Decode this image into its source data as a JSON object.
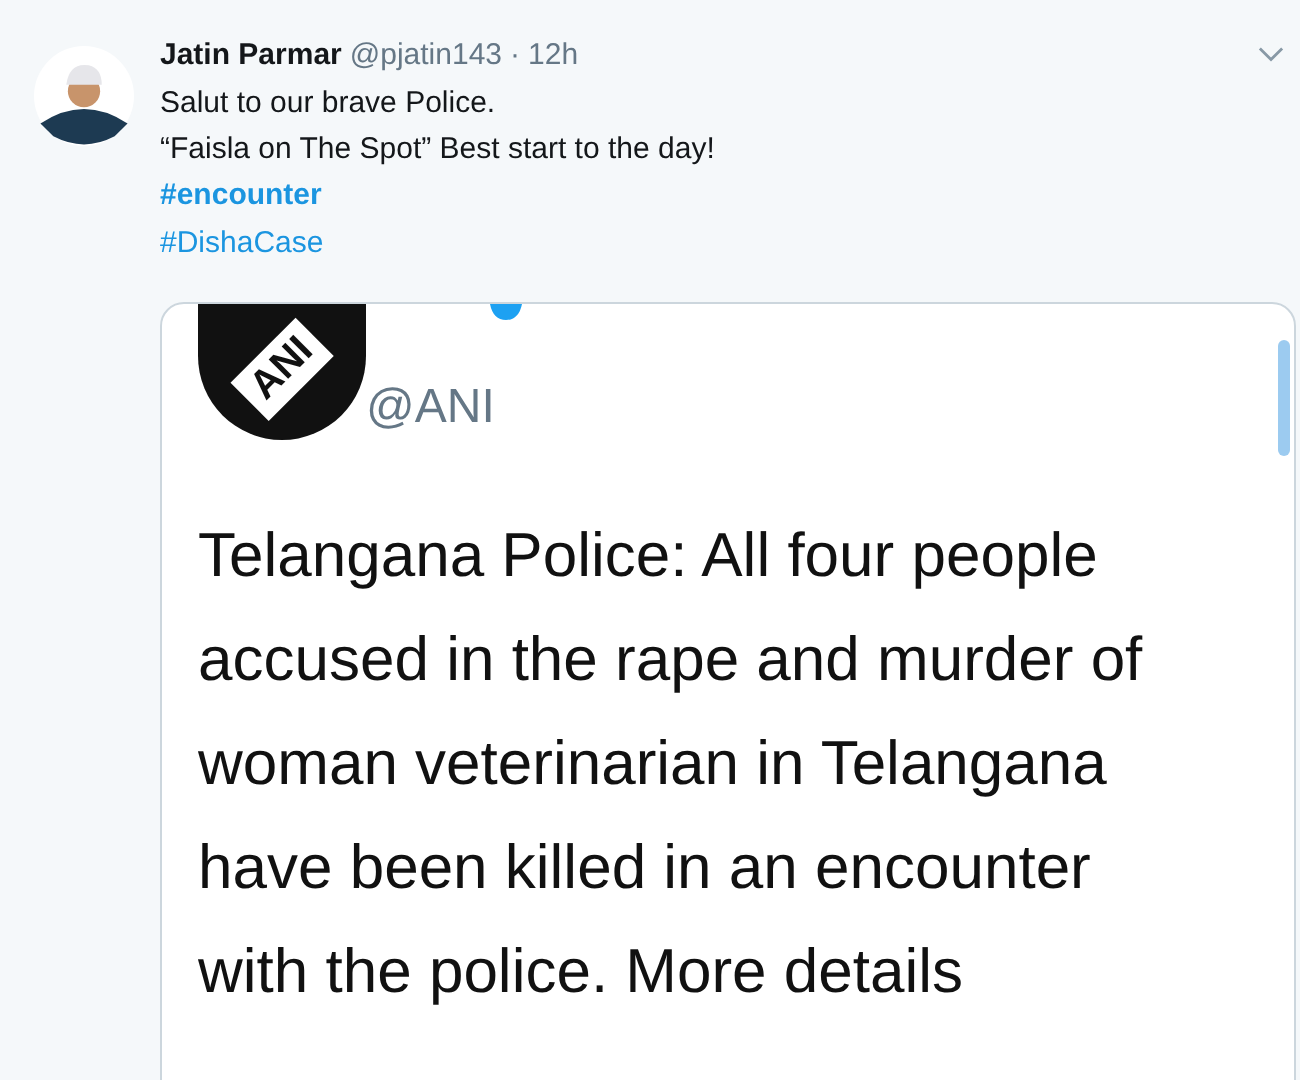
{
  "tweet": {
    "name": "Jatin Parmar",
    "handle": "@pjatin143",
    "separator": "·",
    "time": "12h",
    "lines": [
      "Salut to our brave Police.",
      "“Faisla on The Spot” Best start to the day!"
    ],
    "hashtags": [
      {
        "text": "#encounter",
        "bold": true
      },
      {
        "text": "#DishaCase",
        "bold": false
      }
    ]
  },
  "embedded_screenshot": {
    "logo_text": "ANI",
    "handle": "@ANI",
    "text_lines": [
      "Telangana Police: All four people",
      "accused in the rape and murder of",
      "woman veterinarian in Telangana",
      "have been killed in an encounter",
      "with the police. More details"
    ]
  }
}
